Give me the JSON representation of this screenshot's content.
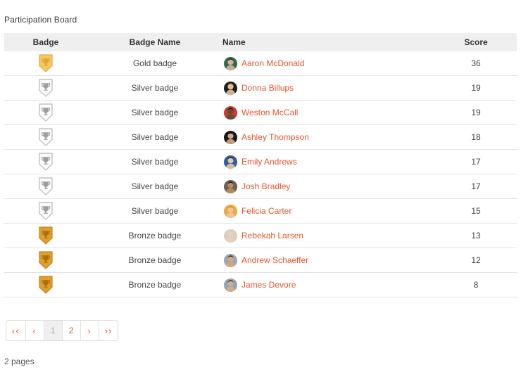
{
  "board": {
    "title": "Participation Board",
    "columns": {
      "badge": "Badge",
      "badge_name": "Badge Name",
      "name": "Name",
      "score": "Score"
    },
    "rows": [
      {
        "badge_type": "gold",
        "badge_name": "Gold badge",
        "name": "Aaron McDonald",
        "score": "36"
      },
      {
        "badge_type": "silver",
        "badge_name": "Silver badge",
        "name": "Donna Billups",
        "score": "19"
      },
      {
        "badge_type": "silver",
        "badge_name": "Silver badge",
        "name": "Weston McCall",
        "score": "19"
      },
      {
        "badge_type": "silver",
        "badge_name": "Silver badge",
        "name": "Ashley Thompson",
        "score": "18"
      },
      {
        "badge_type": "silver",
        "badge_name": "Silver badge",
        "name": "Emily Andrews",
        "score": "17"
      },
      {
        "badge_type": "silver",
        "badge_name": "Silver badge",
        "name": "Josh Bradley",
        "score": "17"
      },
      {
        "badge_type": "silver",
        "badge_name": "Silver badge",
        "name": "Felicia Carter",
        "score": "15"
      },
      {
        "badge_type": "bronze",
        "badge_name": "Bronze badge",
        "name": "Rebekah Larsen",
        "score": "13"
      },
      {
        "badge_type": "bronze",
        "badge_name": "Bronze badge",
        "name": "Andrew Schaeffer",
        "score": "12"
      },
      {
        "badge_type": "bronze",
        "badge_name": "Bronze badge",
        "name": "James Devore",
        "score": "8"
      }
    ]
  },
  "pagination": {
    "first_label": "‹‹",
    "prev_label": "‹",
    "next_label": "›",
    "last_label": "››",
    "pages": [
      "1",
      "2"
    ],
    "current_page": "1",
    "summary": "2 pages"
  },
  "icons": {
    "badge": "shield-trophy-icon",
    "first": "double-chevron-left-icon",
    "prev": "chevron-left-icon",
    "next": "chevron-right-icon",
    "last": "double-chevron-right-icon",
    "avatar": "user-avatar-icon"
  },
  "colors": {
    "link": "#e8552d",
    "header_bg": "#efefef",
    "row_border": "#e4e4e4",
    "gold": "#f5c462",
    "silver": "#c9c9c9",
    "bronze": "#d79b2a",
    "text": "#444444"
  }
}
